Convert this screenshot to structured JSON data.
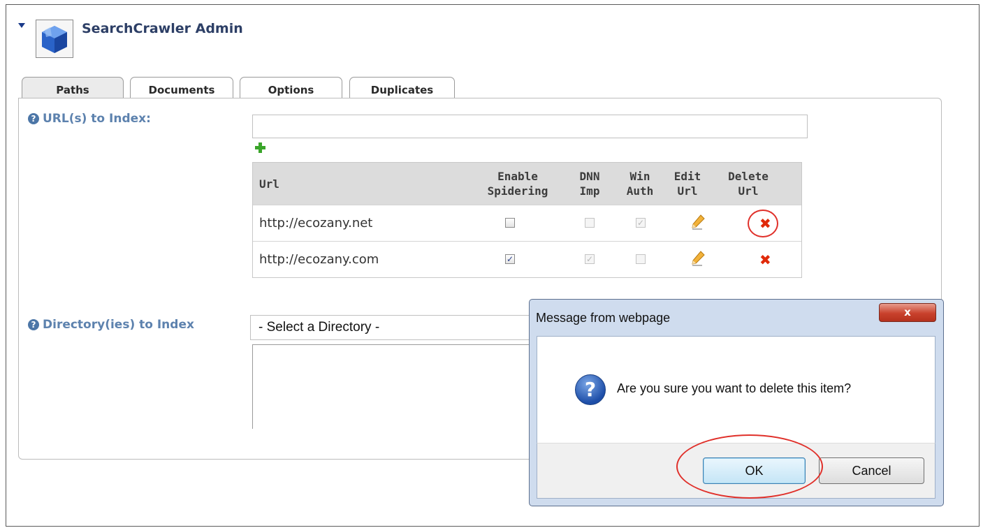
{
  "header": {
    "title": "SearchCrawler Admin"
  },
  "tabs": [
    {
      "label": "Paths",
      "active": true
    },
    {
      "label": "Documents",
      "active": false
    },
    {
      "label": "Options",
      "active": false
    },
    {
      "label": "Duplicates",
      "active": false
    }
  ],
  "urls_section": {
    "label": "URL(s) to Index:",
    "input_value": "",
    "columns": {
      "url": "Url",
      "enable_line1": "Enable",
      "enable_line2": "Spidering",
      "dnn_line1": "DNN",
      "dnn_line2": "Imp",
      "win_line1": "Win",
      "win_line2": "Auth",
      "edit_line1": "Edit",
      "edit_line2": "Url",
      "delete_line1": "Delete",
      "delete_line2": "Url"
    },
    "rows": [
      {
        "url": "http://ecozany.net",
        "enable_spidering": false,
        "dnn_imp": false,
        "win_auth": true
      },
      {
        "url": "http://ecozany.com",
        "enable_spidering": true,
        "dnn_imp": true,
        "win_auth": false
      }
    ]
  },
  "directories_section": {
    "label": "Directory(ies) to Index",
    "select_value": "- Select a Directory -"
  },
  "dialog": {
    "title": "Message from webpage",
    "close_label": "x",
    "message": "Are you sure you want to delete this item?",
    "ok_label": "OK",
    "cancel_label": "Cancel"
  },
  "icons": {
    "help": "?",
    "question": "?",
    "delete": "✖",
    "check": "✓"
  },
  "colors": {
    "title_text": "#2d3f66",
    "label_text": "#5d82ae",
    "grid_header_bg": "#dcdcdc",
    "delete_red": "#e02a0a",
    "dialog_frame": "#cfdcee",
    "highlight_circle": "#e0302a"
  }
}
